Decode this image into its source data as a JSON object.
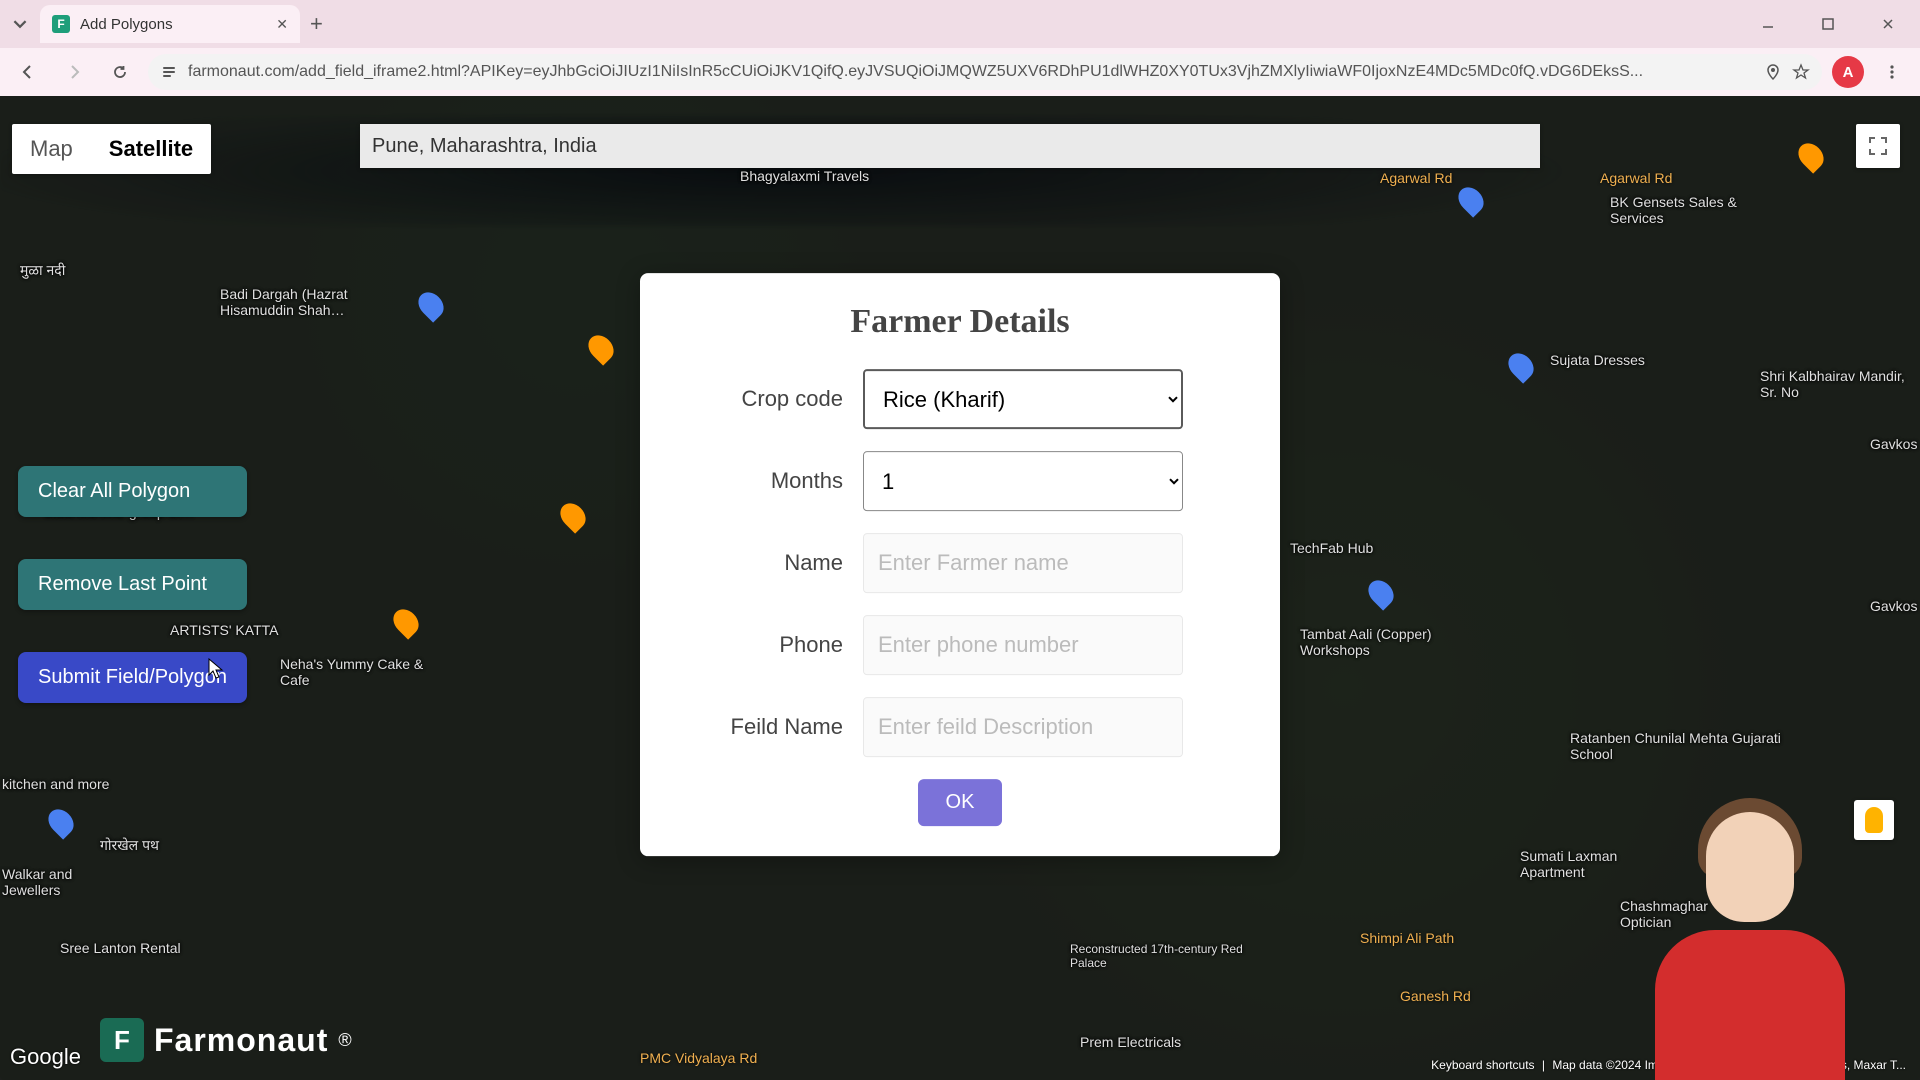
{
  "browser": {
    "tab_title": "Add Polygons",
    "url": "farmonaut.com/add_field_iframe2.html?APIKey=eyJhbGciOiJIUzI1NiIsInR5cCUiOiJKV1QifQ.eyJVSUQiOiJMQWZ5UXV6RDhPU1dlWHZ0XY0TUx3VjhZMXlyIiwiaWF0IjoxNzE4MDc5MDc0fQ.vDG6DEksS...",
    "profile_initial": "A"
  },
  "map": {
    "type_map": "Map",
    "type_satellite": "Satellite",
    "search_value": "Pune, Maharashtra, India",
    "google": "Google",
    "attribution": {
      "shortcuts": "Keyboard shortcuts",
      "data": "Map data ©2024  Imagery ©2024 Airbus, CNES / Airbus, Maxar T..."
    }
  },
  "buttons": {
    "clear": "Clear All Polygon",
    "remove": "Remove Last Point",
    "submit": "Submit Field/Polygon"
  },
  "logo": {
    "brand": "Farmonaut",
    "reg": "®"
  },
  "modal": {
    "title": "Farmer Details",
    "crop_label": "Crop code",
    "crop_value": "Rice (Kharif)",
    "months_label": "Months",
    "months_value": "1",
    "name_label": "Name",
    "name_placeholder": "Enter Farmer name",
    "phone_label": "Phone",
    "phone_placeholder": "Enter phone number",
    "field_label": "Feild Name",
    "field_placeholder": "Enter feild Description",
    "ok": "OK"
  },
  "places": {
    "travels": "Bhagyalaxmi Travels",
    "dargah": "Badi Dargah (Hazrat Hisamuddin Shah…",
    "siddh": "Siddheshwar group of…",
    "artists": "ARTISTS' KATTA",
    "nehas": "Neha's Yummy Cake & Cafe",
    "kitchen": "kitchen and more",
    "walkar": "Walkar and Jewellers",
    "sree": "Sree Lanton Rental",
    "agarwal": "Agarwal Rd",
    "bkg": "BK Gensets Sales & Services",
    "sujata": "Sujata Dresses",
    "shri": "Shri Kalbhairav Mandir, Sr. No",
    "tech": "TechFab Hub",
    "tambat": "Tambat Aali (Copper) Workshops",
    "ratanben": "Ratanben Chunilal Mehta Gujarati School",
    "sumati": "Sumati Laxman Apartment",
    "chash": "Chashmaghar Optician",
    "shimpi": "Shimpi Ali Path",
    "ganesh": "Ganesh Rd",
    "prem": "Prem Electricals",
    "pmc": "PMC Vidyalaya Rd",
    "temple": "Reconstructed 17th-century Red Palace",
    "mula": "मुळा नदी",
    "gavk1": "Gavkos",
    "gavk2": "Gavkos",
    "garikhel": "गोरखेल पथ"
  }
}
